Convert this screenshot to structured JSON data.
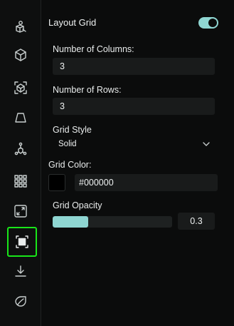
{
  "sidebar": {
    "items": [
      {
        "icon": "shapes-3d-icon"
      },
      {
        "icon": "cube-icon"
      },
      {
        "icon": "cube-focus-icon"
      },
      {
        "icon": "trapezoid-icon"
      },
      {
        "icon": "node-tree-icon"
      },
      {
        "icon": "grid-9-icon"
      },
      {
        "icon": "resize-arrows-icon"
      },
      {
        "icon": "layout-grid-icon",
        "active": true
      },
      {
        "icon": "download-icon"
      },
      {
        "icon": "leaf-icon"
      }
    ]
  },
  "panel": {
    "title": "Layout Grid",
    "enabled": true,
    "columns_label": "Number of Columns:",
    "columns_value": "3",
    "rows_label": "Number of Rows:",
    "rows_value": "3",
    "style_label": "Grid Style",
    "style_value": "Solid",
    "color_label": "Grid Color:",
    "color_value": "#000000",
    "opacity_label": "Grid Opacity",
    "opacity_value": "0.3"
  },
  "colors": {
    "accent": "#8fd6d2",
    "active_outline": "#19e619",
    "background": "#0b0c0c",
    "input_bg": "#191b1b"
  }
}
